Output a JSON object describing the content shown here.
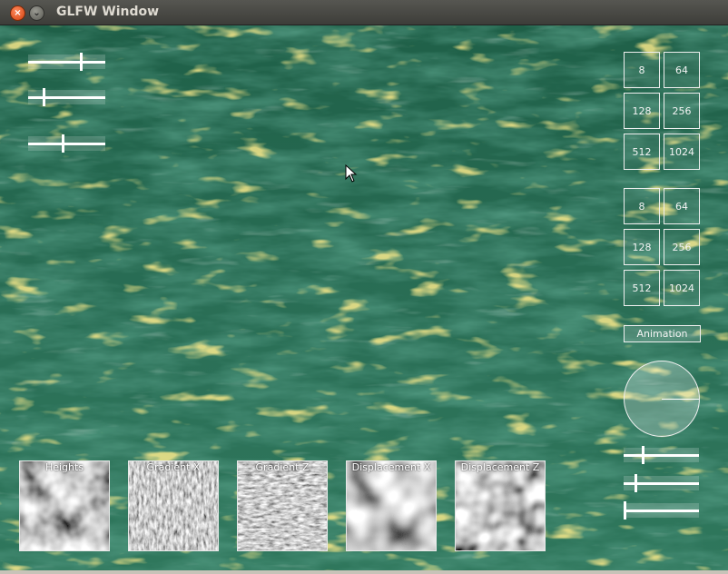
{
  "window": {
    "title": "GLFW Window"
  },
  "resolution_groups": [
    {
      "buttons": [
        "8",
        "64",
        "128",
        "256",
        "512",
        "1024"
      ]
    },
    {
      "buttons": [
        "8",
        "64",
        "128",
        "256",
        "512",
        "1024"
      ]
    }
  ],
  "animation_button": "Animation",
  "left_sliders": [
    {
      "value": 0.7
    },
    {
      "value": 0.2
    },
    {
      "value": 0.45
    }
  ],
  "right_sliders": [
    {
      "value": 0.25
    },
    {
      "value": 0.15
    },
    {
      "value": 0.0
    }
  ],
  "textures": [
    {
      "label": "Heights"
    },
    {
      "label": "Gradient X"
    },
    {
      "label": "Gradient Z"
    },
    {
      "label": "Displacement X"
    },
    {
      "label": "Displacement Z"
    }
  ],
  "colors": {
    "water": "#2c6e55",
    "foam": "#e8c84a",
    "ui": "#ffffff"
  }
}
